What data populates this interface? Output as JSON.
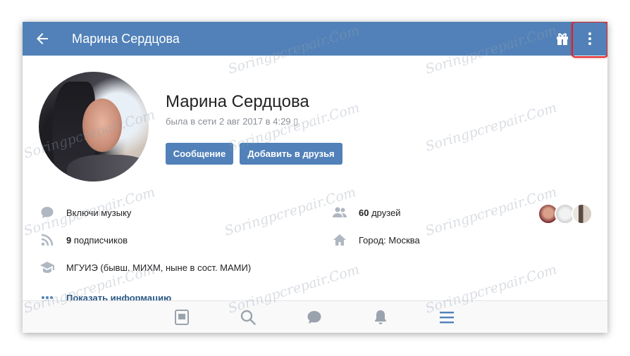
{
  "header": {
    "title": "Марина Сердцова"
  },
  "profile": {
    "name": "Марина Сердцова",
    "status": "была в сети 2 авг 2017 в 4:29 ▯",
    "actions": {
      "message_label": "Сообщение",
      "add_friend_label": "Добавить в друзья"
    }
  },
  "info": {
    "music": "Включи музыку",
    "followers": {
      "count": "9",
      "label": "подписчиков"
    },
    "education": "МГУИЭ (бывш. МИХМ, ныне в сост. МАМИ)",
    "friends": {
      "count": "60",
      "label": "друзей"
    },
    "city": "Город: Москва",
    "show_more": "Показать информацию"
  },
  "friends_preview_count": 3,
  "watermark": "Soringpcrepair.Com",
  "colors": {
    "brand": "#5181b8",
    "highlight": "#e02020",
    "icon_gray": "#aeb7c2",
    "link": "#2a5885"
  },
  "icons": {
    "header": [
      "arrow-left-icon",
      "gift-icon",
      "more-vertical-icon"
    ],
    "tabs": [
      "news-icon",
      "search-icon",
      "messages-icon",
      "notifications-icon",
      "menu-icon"
    ]
  }
}
